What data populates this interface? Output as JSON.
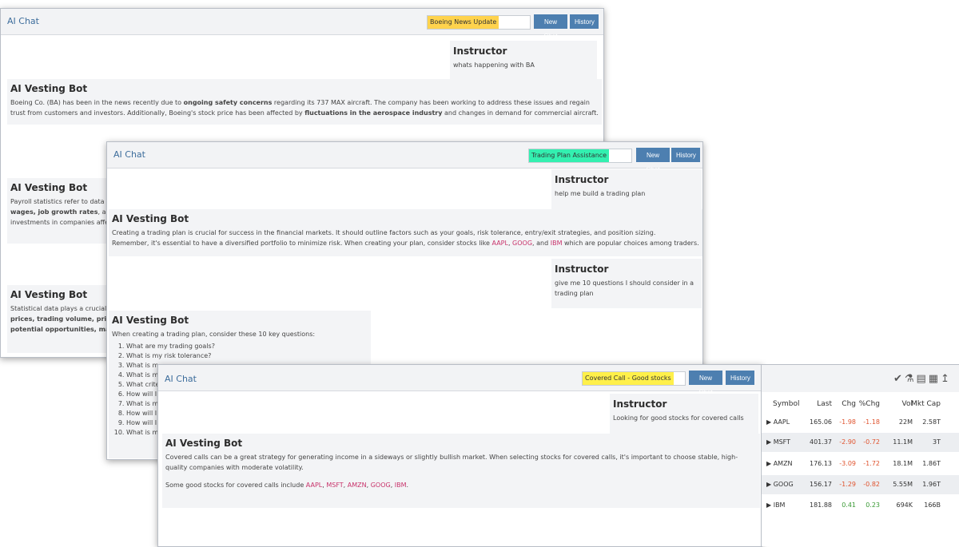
{
  "window1": {
    "title": "AI Chat",
    "topic": "Boeing News Update",
    "new_chat": "New Chat",
    "history": "History",
    "instructor_name": "Instructor",
    "instructor_msg": "whats happening with BA",
    "bot1_name": "AI Vesting Bot",
    "bot1_line1_a": "Boeing Co. (BA) has been in the news recently due to ",
    "bot1_line1_b": "ongoing safety concerns",
    "bot1_line1_c": " regarding its 737 MAX aircraft. The company has been working to address these issues and regain",
    "bot1_line2_a": "trust from customers and investors. Additionally, Boeing's stock price has been affected by ",
    "bot1_line2_b": "fluctuations in the aerospace industry",
    "bot1_line2_c": " and changes in demand for commercial aircraft.",
    "bot2_name": "AI Vesting Bot",
    "bot2_line1": "Payroll statistics refer to data",
    "bot2_line2_a": "wages, job growth rates",
    "bot2_line2_b": ", and c",
    "bot2_line3": "investments in companies affe",
    "bot3_name": "AI Vesting Bot",
    "bot3_line1": "Statistical data plays a crucial",
    "bot3_line2": "prices, trading volume, price-",
    "bot3_line3": "potential opportunities, manag"
  },
  "window2": {
    "title": "AI Chat",
    "topic": "Trading Plan Assistance",
    "new_chat": "New Chat",
    "history": "History",
    "instructor1_name": "Instructor",
    "instructor1_msg": "help me build a trading plan",
    "bot1_name": "AI Vesting Bot",
    "bot1_line1": "Creating a trading plan is crucial for success in the financial markets. It should outline factors such as your goals, risk tolerance, entry/exit strategies, and position sizing.",
    "bot1_line2_a": "Remember, it's essential to have a diversified portfolio to minimize risk. When creating your plan, consider stocks like ",
    "tk1": "AAPL",
    "sep1": ", ",
    "tk2": "GOOG",
    "sep2": ", and ",
    "tk3": "IBM",
    "bot1_line2_b": " which are popular choices among traders.",
    "instructor2_name": "Instructor",
    "instructor2_line1": "give me 10 questions I should consider in a",
    "instructor2_line2": "trading plan",
    "bot2_name": "AI Vesting Bot",
    "bot2_intro": "When creating a trading plan, consider these 10 key questions:",
    "questions": [
      "What are my trading goals?",
      "What is my risk tolerance?",
      "What is m",
      "What is m",
      "What crite",
      "How will I",
      "What is m",
      "How will I",
      "How will I",
      "What is m"
    ]
  },
  "window3": {
    "title": "AI Chat",
    "topic": "Covered Call - Good stocks",
    "new_chat": "New Chat",
    "history": "History",
    "instructor_name": "Instructor",
    "instructor_msg": "Looking for good stocks for covered calls",
    "bot_name": "AI Vesting Bot",
    "bot_line1": "Covered calls can be a great strategy for generating income in a sideways or slightly bullish market. When selecting stocks for covered calls, it's important to choose stable, high-",
    "bot_line2": "quality companies with moderate volatility.",
    "bot_line3_a": "Some good stocks for covered calls include ",
    "tk1": "AAPL",
    "tk2": "MSFT",
    "tk3": "AMZN",
    "tk4": "GOOG",
    "tk5": "IBM",
    "comma": ", ",
    "end": "."
  },
  "watchlist": {
    "icons": [
      "check-circle-icon",
      "flask-icon",
      "folder-icon",
      "save-icon",
      "upload-icon"
    ],
    "headers": {
      "symbol": "Symbol",
      "last": "Last",
      "chg": "Chg",
      "pchg": "%Chg",
      "vol": "Vol",
      "mktcap": "Mkt Cap"
    },
    "rows": [
      {
        "symbol": "AAPL",
        "last": "165.06",
        "chg": "-1.98",
        "pchg": "-1.18",
        "vol": "22M",
        "mktcap": "2.58T"
      },
      {
        "symbol": "MSFT",
        "last": "401.37",
        "chg": "-2.90",
        "pchg": "-0.72",
        "vol": "11.1M",
        "mktcap": "3T"
      },
      {
        "symbol": "AMZN",
        "last": "176.13",
        "chg": "-3.09",
        "pchg": "-1.72",
        "vol": "18.1M",
        "mktcap": "1.86T"
      },
      {
        "symbol": "GOOG",
        "last": "156.17",
        "chg": "-1.29",
        "pchg": "-0.82",
        "vol": "5.55M",
        "mktcap": "1.96T"
      },
      {
        "symbol": "IBM",
        "last": "181.88",
        "chg": "0.41",
        "pchg": "0.23",
        "vol": "694K",
        "mktcap": "166B"
      }
    ]
  }
}
